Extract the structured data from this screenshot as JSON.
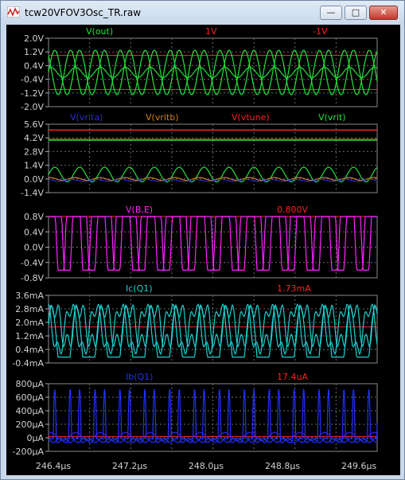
{
  "window": {
    "title": "tcw20VFOV3Osc_TR.raw",
    "minimize": "—",
    "maximize": "□",
    "close": "✕"
  },
  "icons": {
    "app": "waveform-icon"
  },
  "colors": {
    "green": "#23e23a",
    "red": "#ff2020",
    "magenta": "#ff22ff",
    "cyan": "#1ecfcf",
    "blue": "#2030ff",
    "orange": "#d08020",
    "darkblue": "#2a2ad0",
    "grid": "#6a6a6a"
  },
  "x_axis": {
    "ticks": [
      "246.4µs",
      "247.2µs",
      "248.0µs",
      "248.8µs",
      "249.6µs"
    ]
  },
  "panes": [
    {
      "id": "out",
      "labels": [
        {
          "text": "V(out)",
          "color": "#23e23a"
        },
        {
          "text": "1V",
          "color": "#ff2020"
        },
        {
          "text": "-1V",
          "color": "#ff2020"
        }
      ],
      "yticks": [
        "2.0V",
        "1.2V",
        "0.4V",
        "-0.4V",
        "-1.2V",
        "-2.0V"
      ]
    },
    {
      "id": "vrit",
      "labels": [
        {
          "text": "V(vrita)",
          "color": "#2a2ad0"
        },
        {
          "text": "V(vritb)",
          "color": "#d08020"
        },
        {
          "text": "V(vtune)",
          "color": "#ff2020"
        },
        {
          "text": "V(vrit)",
          "color": "#23e23a"
        }
      ],
      "yticks": [
        "5.6V",
        "4.2V",
        "2.8V",
        "1.4V",
        "0.0V",
        "-1.4V"
      ]
    },
    {
      "id": "vbe",
      "labels": [
        {
          "text": "V(B,E)",
          "color": "#ff22ff"
        },
        {
          "text": "0.800V",
          "color": "#ff2020"
        }
      ],
      "yticks": [
        "0.8V",
        "0.4V",
        "0.0V",
        "-0.4V",
        "-0.8V"
      ]
    },
    {
      "id": "ic",
      "labels": [
        {
          "text": "Ic(Q1)",
          "color": "#1ecfcf"
        },
        {
          "text": "1.73mA",
          "color": "#ff2020"
        }
      ],
      "yticks": [
        "3.6mA",
        "2.8mA",
        "2.0mA",
        "1.2mA",
        "0.4mA",
        "-0.4mA"
      ]
    },
    {
      "id": "ib",
      "labels": [
        {
          "text": "Ib(Q1)",
          "color": "#2030ff"
        },
        {
          "text": "17.4uA",
          "color": "#ff2020"
        }
      ],
      "yticks": [
        "800µA",
        "600µA",
        "400µA",
        "200µA",
        "0µA",
        "-200µA"
      ]
    }
  ],
  "chart_data": [
    {
      "type": "line",
      "title": "V(out)",
      "series": [
        {
          "name": "V(out)"
        }
      ],
      "ylim": [
        -2.0,
        2.0
      ],
      "cursors": [
        1,
        -1
      ],
      "x_range": [
        "246.4µs",
        "249.6µs"
      ]
    },
    {
      "type": "line",
      "series": [
        {
          "name": "V(vrita)"
        },
        {
          "name": "V(vritb)"
        },
        {
          "name": "V(vtune)"
        },
        {
          "name": "V(vrit)"
        }
      ],
      "ylim": [
        -1.4,
        5.6
      ],
      "levels": {
        "V(vtune)": 5.0,
        "V(vritb)": 4.0
      }
    },
    {
      "type": "line",
      "series": [
        {
          "name": "V(B,E)"
        }
      ],
      "ylim": [
        -0.8,
        0.8
      ],
      "cursor": 0.8
    },
    {
      "type": "line",
      "series": [
        {
          "name": "Ic(Q1)"
        }
      ],
      "ylim": [
        -0.4,
        3.6
      ],
      "cursor": 1.73
    },
    {
      "type": "line",
      "series": [
        {
          "name": "Ib(Q1)"
        }
      ],
      "ylim": [
        -200,
        800
      ],
      "cursor": 17.4
    }
  ]
}
